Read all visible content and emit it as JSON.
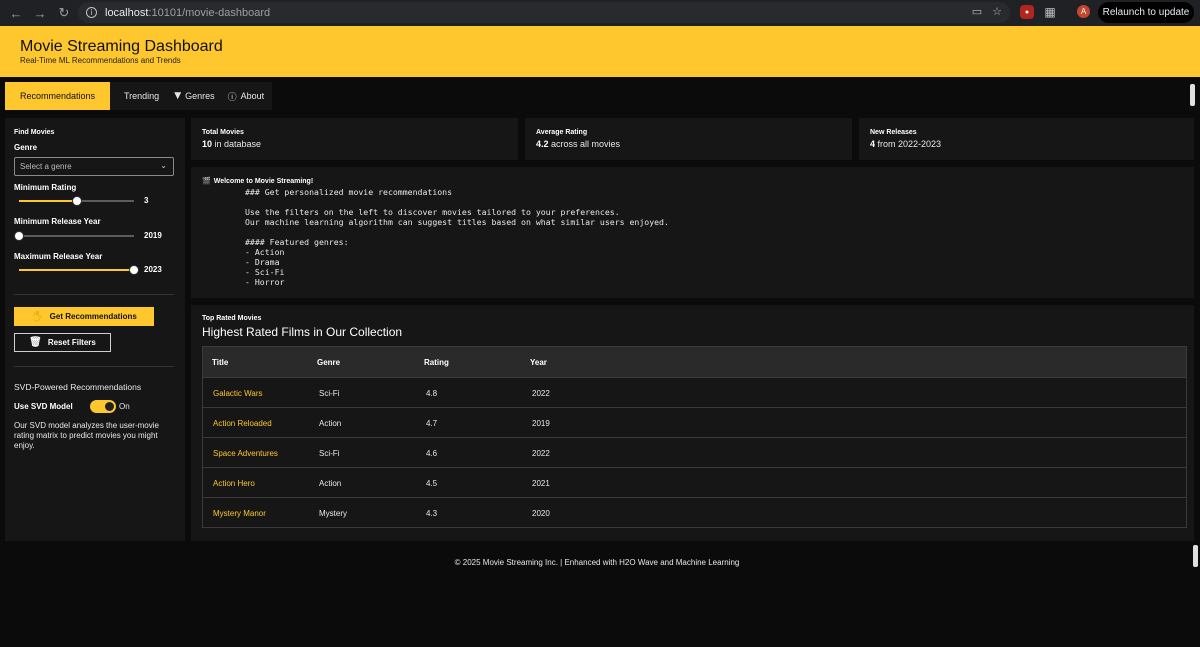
{
  "browser": {
    "url_host": "localhost",
    "url_path": ":10101/movie-dashboard",
    "relaunch_label": "Relaunch to update",
    "avatar_letter": "A"
  },
  "header": {
    "title": "Movie Streaming Dashboard",
    "subtitle": "Real-Time ML Recommendations and Trends"
  },
  "tabs": [
    {
      "label": "Recommendations",
      "active": true
    },
    {
      "label": "Trending"
    },
    {
      "label": "Genres",
      "icon": "filter-icon"
    },
    {
      "label": "About",
      "icon": "info-icon"
    }
  ],
  "sidebar": {
    "heading": "Find Movies",
    "genre_label": "Genre",
    "genre_placeholder": "Select a genre",
    "min_rating_label": "Minimum Rating",
    "min_rating_value": "3",
    "min_rating_fraction": 0.5,
    "min_year_label": "Minimum Release Year",
    "min_year_value": "2019",
    "min_year_fraction": 0.0,
    "max_year_label": "Maximum Release Year",
    "max_year_value": "2023",
    "max_year_fraction": 1.0,
    "get_recs_label": "Get Recommendations",
    "reset_label": "Reset Filters",
    "svd_heading": "SVD-Powered Recommendations",
    "svd_toggle_label": "Use SVD Model",
    "svd_toggle_state": "On",
    "svd_description": "Our SVD model analyzes the user-movie rating matrix to predict movies you might enjoy."
  },
  "stats": [
    {
      "label": "Total Movies",
      "value": "10",
      "suffix": " in database"
    },
    {
      "label": "Average Rating",
      "value": "4.2",
      "suffix": " across all movies"
    },
    {
      "label": "New Releases",
      "value": "4",
      "suffix": " from 2022-2023"
    }
  ],
  "welcome": {
    "title": "Welcome to Movie Streaming!",
    "lines": [
      "### Get personalized movie recommendations",
      "",
      "Use the filters on the left to discover movies tailored to your preferences.",
      "Our machine learning algorithm can suggest titles based on what similar users enjoyed.",
      "",
      "#### Featured genres:",
      "- Action",
      "- Drama",
      "- Sci-Fi",
      "- Horror"
    ]
  },
  "top_rated": {
    "small_title": "Top Rated Movies",
    "title": "Highest Rated Films in Our Collection",
    "columns": [
      "Title",
      "Genre",
      "Rating",
      "Year"
    ],
    "rows": [
      {
        "title": "Galactic Wars",
        "genre": "Sci-Fi",
        "rating": "4.8",
        "year": "2022"
      },
      {
        "title": "Action Reloaded",
        "genre": "Action",
        "rating": "4.7",
        "year": "2019"
      },
      {
        "title": "Space Adventures",
        "genre": "Sci-Fi",
        "rating": "4.6",
        "year": "2022"
      },
      {
        "title": "Action Hero",
        "genre": "Action",
        "rating": "4.5",
        "year": "2021"
      },
      {
        "title": "Mystery Manor",
        "genre": "Mystery",
        "rating": "4.3",
        "year": "2020"
      }
    ]
  },
  "footer": {
    "text": "© 2025 Movie Streaming Inc. | Enhanced with H2O Wave and Machine Learning"
  }
}
